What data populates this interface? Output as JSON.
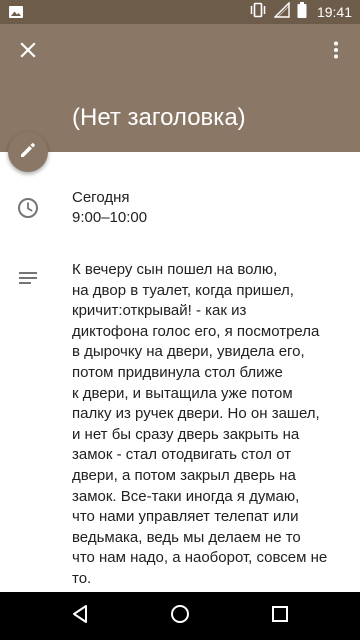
{
  "status_bar": {
    "time": "19:41",
    "icons": [
      "image-icon",
      "vibrate-icon",
      "signal-icon",
      "battery-icon"
    ]
  },
  "header": {
    "title": "(Нет заголовка)",
    "icons": [
      "close-icon",
      "more-vert-icon",
      "edit-icon"
    ]
  },
  "event": {
    "date_label": "Сегодня",
    "time_range": "9:00–10:00",
    "description": "К вечеру сын пошел на волю,\nна двор в туалет, когда пришел,\nкричит:открывай! - как из\nдиктофона голос его, я посмотрела\nв дырочку на двери, увидела его,\nпотом придвинула стол ближе\nк двери, и вытащила уже потом\nпалку из ручек двери. Но он зашел,\nи нет бы сразу дверь закрыть на\nзамок - стал отодвигать стол от\nдвери, а потом закрыл дверь на\nзамок. Все-таки иногда я думаю,\nчто нами управляет телепат или\nведьмака, ведь мы делаем не то\nчто нам надо, а наоборот, совсем не\nто."
  },
  "nav_bar": {
    "icons": [
      "back-icon",
      "home-icon",
      "recents-icon"
    ]
  },
  "colors": {
    "header": "#8b7765",
    "status_bar": "#6e5c4b",
    "text": "#212121",
    "icon_gray": "#757575"
  }
}
